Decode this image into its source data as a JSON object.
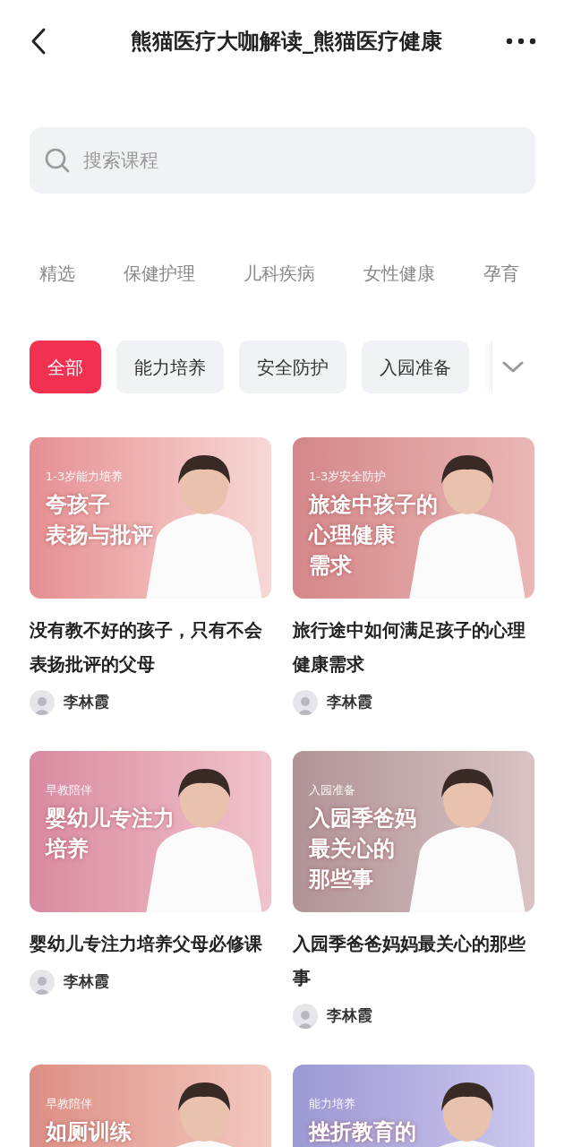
{
  "header": {
    "title": "熊猫医疗大咖解读_熊猫医疗健康"
  },
  "search": {
    "placeholder": "搜索课程"
  },
  "categories": [
    {
      "label": "精选",
      "selected": false
    },
    {
      "label": "保健护理",
      "selected": false
    },
    {
      "label": "儿科疾病",
      "selected": false
    },
    {
      "label": "女性健康",
      "selected": false
    },
    {
      "label": "孕育",
      "selected": false
    }
  ],
  "filters": [
    {
      "label": "全部",
      "selected": true
    },
    {
      "label": "能力培养",
      "selected": false
    },
    {
      "label": "安全防护",
      "selected": false
    },
    {
      "label": "入园准备",
      "selected": false
    }
  ],
  "courses": [
    {
      "tag": "1-3岁能力培养",
      "banner": [
        "夸孩子",
        "表扬与批评"
      ],
      "title": "没有教不好的孩子，只有不会表扬批评的父母",
      "author": "李林霞"
    },
    {
      "tag": "1-3岁安全防护",
      "banner": [
        "旅途中孩子的",
        "心理健康",
        "需求"
      ],
      "title": "旅行途中如何满足孩子的心理健康需求",
      "author": "李林霞"
    },
    {
      "tag": "早教陪伴",
      "banner": [
        "婴幼儿专注力",
        "培养"
      ],
      "title": "婴幼儿专注力培养父母必修课",
      "author": "李林霞"
    },
    {
      "tag": "入园准备",
      "banner": [
        "入园季爸妈",
        "最关心的",
        "那些事"
      ],
      "title": "入园季爸爸妈妈最关心的那些事",
      "author": "李林霞"
    },
    {
      "tag": "早教陪伴",
      "banner": [
        "如厕训练"
      ]
    },
    {
      "tag": "能力培养",
      "banner": [
        "挫折教育的"
      ]
    }
  ]
}
